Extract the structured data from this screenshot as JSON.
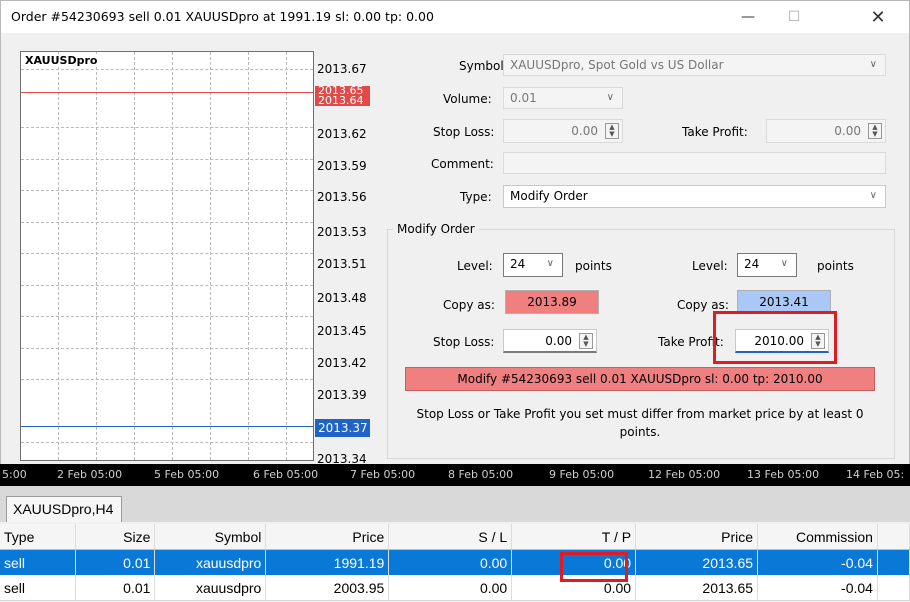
{
  "window": {
    "title": "Order #54230693 sell 0.01 XAUUSDpro at 1991.19 sl: 0.00 tp: 0.00",
    "minimize_icon": "minimize-icon",
    "maximize_icon": "maximize-icon",
    "close_icon": "close-icon"
  },
  "chart": {
    "symbol_label": "XAUUSDpro",
    "price_labels": [
      "2013.67",
      "2013.65",
      "2013.62",
      "2013.59",
      "2013.56",
      "2013.53",
      "2013.51",
      "2013.48",
      "2013.45",
      "2013.42",
      "2013.39",
      "2013.37",
      "2013.34"
    ],
    "overlap_label": "2013.64",
    "bid_color": "#e24a4a",
    "ask_color": "#1f63c6"
  },
  "form": {
    "symbol_label": "Symbol:",
    "symbol_value": "XAUUSDpro, Spot Gold vs US Dollar",
    "volume_label": "Volume:",
    "volume_value": "0.01",
    "stoploss_label": "Stop Loss:",
    "stoploss_value": "0.00",
    "takeprofit_label": "Take Profit:",
    "takeprofit_value": "0.00",
    "comment_label": "Comment:",
    "comment_value": "",
    "type_label": "Type:",
    "type_value": "Modify Order"
  },
  "modify": {
    "group_title": "Modify Order",
    "level_label": "Level:",
    "level_sl": "24",
    "level_tp": "24",
    "points_label": "points",
    "copyas_label": "Copy as:",
    "copy_sl": "2013.89",
    "copy_tp": "2013.41",
    "sl_label": "Stop Loss:",
    "sl_value": "0.00",
    "tp_label": "Take Profit:",
    "tp_value": "2010.00",
    "modify_button": "Modify #54230693 sell 0.01 XAUUSDpro sl: 0.00 tp: 2010.00",
    "note": "Stop Loss or Take Profit you set must differ from market price by at least 0 points.",
    "copy_sl_color": "#f08080",
    "copy_tp_color": "#a9c8f5"
  },
  "time_axis": [
    "5:00",
    "2 Feb 05:00",
    "5 Feb 05:00",
    "6 Feb 05:00",
    "7 Feb 05:00",
    "8 Feb 05:00",
    "9 Feb 05:00",
    "12 Feb 05:00",
    "13 Feb 05:00",
    "14 Feb 05:"
  ],
  "tabs": {
    "active": "XAUUSDpro,H4"
  },
  "orders": {
    "columns": [
      "Type",
      "Size",
      "Symbol",
      "Price",
      "S / L",
      "T / P",
      "Price",
      "Commission"
    ],
    "rows": [
      [
        "sell",
        "0.01",
        "xauusdpro",
        "1991.19",
        "0.00",
        "0.00",
        "2013.65",
        "-0.04"
      ],
      [
        "sell",
        "0.01",
        "xauusdpro",
        "2003.95",
        "0.00",
        "0.00",
        "2013.65",
        "-0.04"
      ]
    ]
  }
}
